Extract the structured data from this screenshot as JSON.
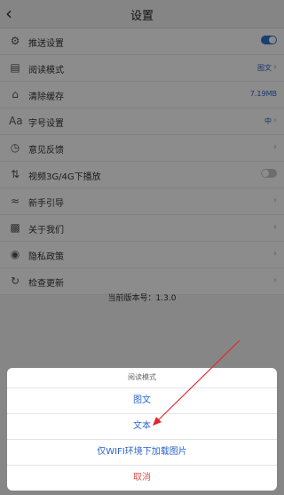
{
  "header": {
    "title": "设置",
    "back_icon": "chevron-left-icon"
  },
  "settings": [
    {
      "icon": "gear-icon",
      "label": "推送设置",
      "toggle": true
    },
    {
      "icon": "reader-icon",
      "label": "阅读模式",
      "value": "图文",
      "chevron": true
    },
    {
      "icon": "broom-icon",
      "label": "清除缓存",
      "value": "7.19MB"
    },
    {
      "icon": "font-size-icon",
      "label": "字号设置",
      "value": "中",
      "chevron": true
    },
    {
      "icon": "feedback-icon",
      "label": "意见反馈",
      "chevron": true
    },
    {
      "icon": "network-icon",
      "label": "视频3G/4G下播放",
      "toggle": false
    },
    {
      "icon": "wifi-icon",
      "label": "新手引导",
      "chevron": true
    },
    {
      "icon": "gamepad-icon",
      "label": "关于我们",
      "chevron": true
    },
    {
      "icon": "privacy-icon",
      "label": "隐私政策",
      "chevron": true
    },
    {
      "icon": "refresh-icon",
      "label": "检查更新",
      "chevron": true
    }
  ],
  "version_text": "当前版本号：1.3.0",
  "sheet": {
    "title": "阅读模式",
    "options": [
      "图文",
      "文本",
      "仅WIFI环境下加载图片"
    ],
    "cancel": "取消"
  },
  "colors": {
    "accent": "#2f74d0",
    "cancel": "#d9534f",
    "annotation_arrow": "#e0282e"
  }
}
